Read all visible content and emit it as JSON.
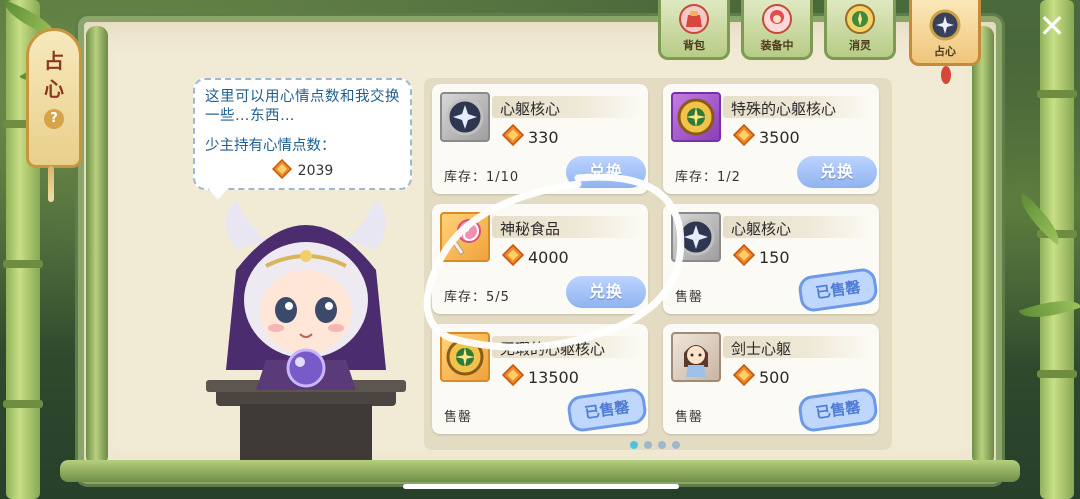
{
  "side_talisman": {
    "chars": [
      "占",
      "心"
    ],
    "help": "?"
  },
  "tabs": [
    {
      "label": "背包",
      "icon": "backpack-icon",
      "active": false
    },
    {
      "label": "装备中",
      "icon": "equipped-character-icon",
      "active": false
    },
    {
      "label": "消灵",
      "icon": "dispel-spirit-icon",
      "active": false
    },
    {
      "label": "占心",
      "icon": "divination-icon",
      "active": true
    }
  ],
  "close": {
    "symbol": "✕"
  },
  "dialog": {
    "intro": "这里可以用心情点数和我交换一些…东西…",
    "hold_label": "少主持有心情点数：",
    "points": "2039"
  },
  "shop": {
    "items": [
      {
        "name": "心躯核心",
        "price": "330",
        "stock": "库存：1/10",
        "state": "exchange",
        "button": "兑换",
        "icon": "gray"
      },
      {
        "name": "特殊的心躯核心",
        "price": "3500",
        "stock": "库存：1/2",
        "state": "exchange",
        "button": "兑换",
        "icon": "purple"
      },
      {
        "name": "神秘食品",
        "price": "4000",
        "stock": "库存：5/5",
        "state": "exchange",
        "button": "兑换",
        "icon": "orange"
      },
      {
        "name": "心躯核心",
        "price": "150",
        "stock": "售罄",
        "state": "sold",
        "button": "已售罄",
        "icon": "gray"
      },
      {
        "name": "无瑕的心躯核心",
        "price": "13500",
        "stock": "售罄",
        "state": "sold",
        "button": "已售罄",
        "icon": "orange"
      },
      {
        "name": "剑士心躯",
        "price": "500",
        "stock": "售罄",
        "state": "sold",
        "button": "已售罄",
        "icon": "portrait"
      }
    ],
    "pages": 4,
    "current_page": 1
  },
  "colors": {
    "accent_blue": "#8fb3f0",
    "gem_orange": "#f08a2a",
    "panel": "#f1ead4"
  }
}
